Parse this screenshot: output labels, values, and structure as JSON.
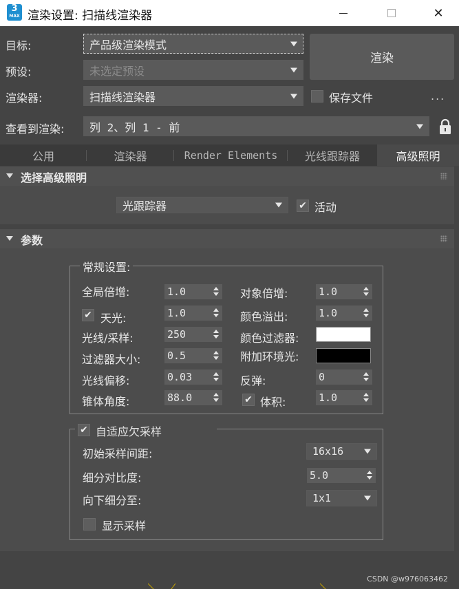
{
  "window": {
    "title": "渲染设置: 扫描线渲染器",
    "icon_text": "3",
    "icon_subtext": "MAX",
    "minimize_icon": "minimize-icon",
    "maximize_icon": "maximize-icon",
    "close_icon": "close-icon",
    "close_glyph": "✕"
  },
  "header": {
    "target_label": "目标:",
    "target_value": "产品级渲染模式",
    "preset_label": "预设:",
    "preset_placeholder": "未选定预设",
    "renderer_label": "渲染器:",
    "renderer_value": "扫描线渲染器",
    "render_button": "渲染",
    "save_file_label": "保存文件",
    "save_file_checked": false,
    "more_label": "...",
    "view_label": "查看到渲染:",
    "view_value": "列 2、列 1 - 前",
    "lock_icon": "lock-icon"
  },
  "tabs": [
    {
      "label": "公用",
      "active": false
    },
    {
      "label": "渲染器",
      "active": false
    },
    {
      "label": "Render Elements",
      "active": false
    },
    {
      "label": "光线跟踪器",
      "active": false
    },
    {
      "label": "高级照明",
      "active": true
    }
  ],
  "select_rollout": {
    "title": "选择高级照明",
    "method_value": "光跟踪器",
    "active_label": "活动",
    "active_checked": true
  },
  "params_rollout": {
    "title": "参数",
    "general_group": {
      "title": "常规设置:",
      "global_multiplier_label": "全局倍增:",
      "global_multiplier_value": "1.0",
      "object_multiplier_label": "对象倍增:",
      "object_multiplier_value": "1.0",
      "skylight_label": "天光:",
      "skylight_checked": true,
      "skylight_value": "1.0",
      "color_bleed_label": "颜色溢出:",
      "color_bleed_value": "1.0",
      "rays_label": "光线/采样:",
      "rays_value": "250",
      "color_filter_label": "颜色过滤器:",
      "color_filter_color": "#ffffff",
      "filter_size_label": "过滤器大小:",
      "filter_size_value": "0.5",
      "extra_ambient_label": "附加环境光:",
      "extra_ambient_color": "#000000",
      "ray_bias_label": "光线偏移:",
      "ray_bias_value": "0.03",
      "bounces_label": "反弹:",
      "bounces_value": "0",
      "cone_angle_label": "锥体角度:",
      "cone_angle_value": "88.0",
      "volume_label": "体积:",
      "volume_checked": true,
      "volume_value": "1.0"
    },
    "adaptive_group": {
      "title": "自适应欠采样",
      "checked": true,
      "initial_spacing_label": "初始采样间距:",
      "initial_spacing_value": "16x16",
      "subdiv_contrast_label": "细分对比度:",
      "subdiv_contrast_value": "5.0",
      "subdivide_down_label": "向下细分至:",
      "subdivide_down_value": "1x1",
      "show_samples_label": "显示采样",
      "show_samples_checked": false
    }
  },
  "watermark": "CSDN @w976063462"
}
